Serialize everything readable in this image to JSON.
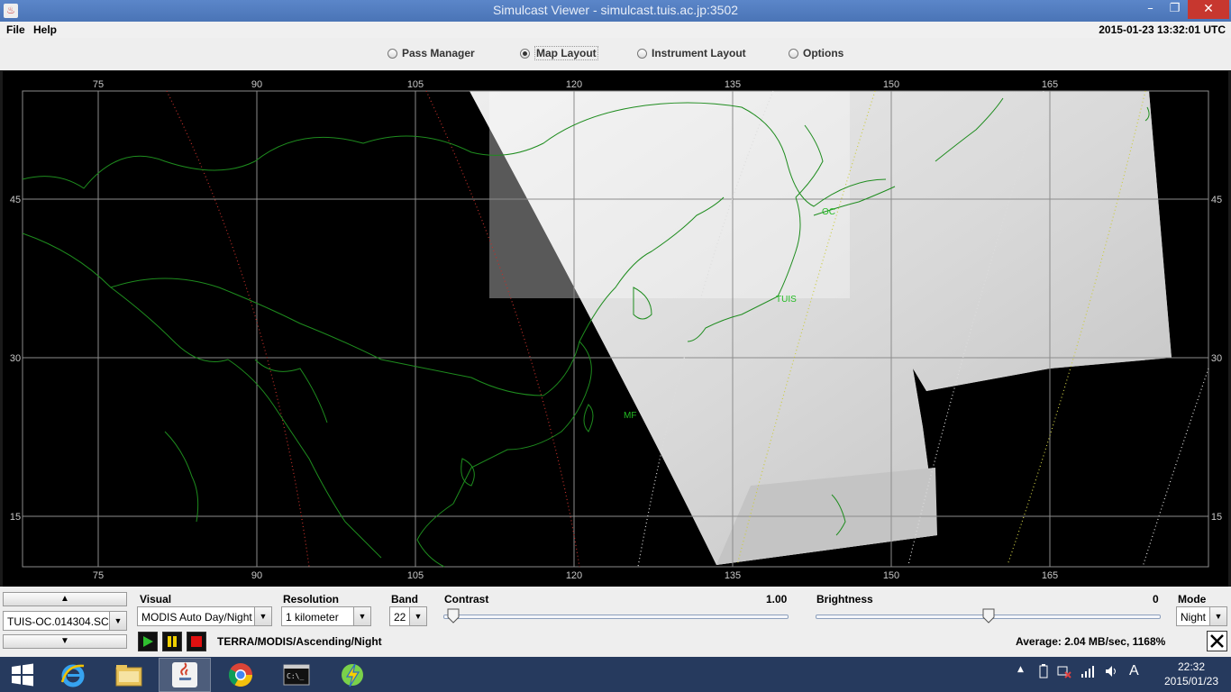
{
  "window": {
    "title": "Simulcast Viewer - simulcast.tuis.ac.jp:3502",
    "minimize_glyph": "–",
    "maximize_glyph": "❐",
    "close_glyph": "✕"
  },
  "menu": {
    "items": [
      "File",
      "Help"
    ],
    "clock": "2015-01-23 13:32:01 UTC"
  },
  "tabs": [
    {
      "label": "Pass Manager",
      "selected": false
    },
    {
      "label": "Map Layout",
      "selected": true
    },
    {
      "label": "Instrument Layout",
      "selected": false
    },
    {
      "label": "Options",
      "selected": false
    }
  ],
  "map": {
    "lon_ticks": [
      "75",
      "90",
      "105",
      "120",
      "135",
      "150",
      "165"
    ],
    "lat_ticks": [
      "45",
      "30",
      "15"
    ],
    "station_labels": [
      "OC",
      "TUIS",
      "MF"
    ],
    "colors": {
      "coastline": "#1e8c1e",
      "grid": "#8c8c8c",
      "track_red": "#c0302a",
      "track_white": "#e0e0e0",
      "track_yellow": "#cccc44",
      "station": "#22bb22"
    }
  },
  "controls": {
    "pass_combo": "TUIS-OC.014304.SC",
    "visual": {
      "label": "Visual",
      "value": "MODIS Auto Day/Night"
    },
    "resolution": {
      "label": "Resolution",
      "value": "1 kilometer"
    },
    "band": {
      "label": "Band",
      "value": "22"
    },
    "contrast": {
      "label": "Contrast",
      "value": "1.00",
      "level": 0.03
    },
    "brightness": {
      "label": "Brightness",
      "value": "0",
      "level": 0.5
    },
    "mode": {
      "label": "Mode",
      "value": "Night"
    },
    "status_text": "TERRA/MODIS/Ascending/Night",
    "throughput": "Average: 2.04 MB/sec, 1168%"
  },
  "taskbar": {
    "apps": [
      "start-icon",
      "internet-explorer-icon",
      "file-explorer-icon",
      "java-icon",
      "chrome-icon",
      "command-prompt-icon",
      "lightning-app-icon"
    ],
    "ime": "A",
    "time": "22:32",
    "date": "2015/01/23"
  }
}
